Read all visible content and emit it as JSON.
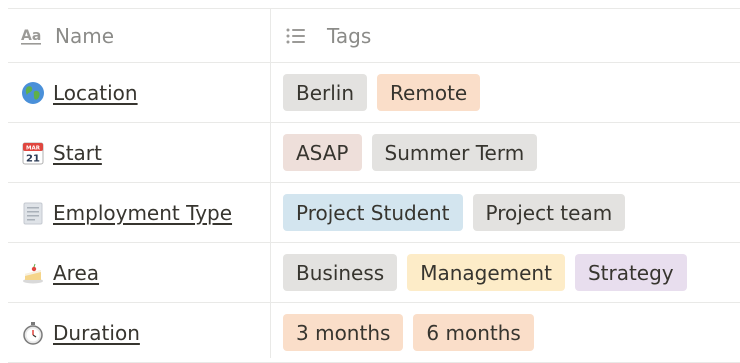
{
  "header": {
    "name_label": "Name",
    "tags_label": "Tags",
    "name_icon": "text-property-icon",
    "tags_icon": "multi-select-icon"
  },
  "rows": [
    {
      "name": "Location",
      "icon": "globe-icon",
      "tags": [
        {
          "label": "Berlin",
          "color": "#e3e2e0"
        },
        {
          "label": "Remote",
          "color": "#fadec9"
        }
      ]
    },
    {
      "name": "Start",
      "icon": "calendar-icon",
      "tags": [
        {
          "label": "ASAP",
          "color": "#eedfda"
        },
        {
          "label": "Summer Term",
          "color": "#e3e2e0"
        }
      ]
    },
    {
      "name": "Employment Type",
      "icon": "page-icon",
      "tags": [
        {
          "label": "Project Student",
          "color": "#d3e5ef"
        },
        {
          "label": "Project team",
          "color": "#e3e2e0"
        }
      ]
    },
    {
      "name": "Area",
      "icon": "cake-icon",
      "tags": [
        {
          "label": "Business",
          "color": "#e3e2e0"
        },
        {
          "label": "Management",
          "color": "#fdecc8"
        },
        {
          "label": "Strategy",
          "color": "#e8deee"
        }
      ]
    },
    {
      "name": "Duration",
      "icon": "stopwatch-icon",
      "tags": [
        {
          "label": "3 months",
          "color": "#fadec9"
        },
        {
          "label": "6 months",
          "color": "#fadec9"
        }
      ]
    }
  ]
}
